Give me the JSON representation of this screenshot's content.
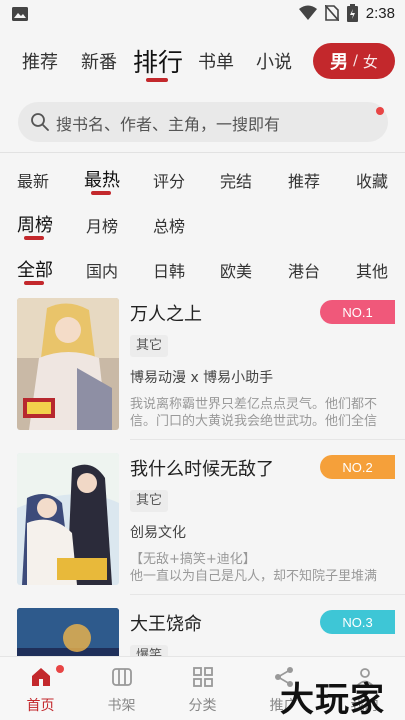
{
  "status_bar": {
    "time": "2:38"
  },
  "top_nav": {
    "tabs": [
      "推荐",
      "新番",
      "排行",
      "书单",
      "小说"
    ],
    "active_index": 2,
    "gender": {
      "male": "男",
      "separator": "/",
      "female": "女"
    }
  },
  "search": {
    "placeholder": "搜书名、作者、主角，一搜即有"
  },
  "filters": {
    "sort": {
      "items": [
        "最新",
        "最热",
        "评分",
        "完结",
        "推荐",
        "收藏"
      ],
      "active_index": 1
    },
    "period": {
      "items": [
        "周榜",
        "月榜",
        "总榜"
      ],
      "active_index": 0
    },
    "region": {
      "items": [
        "全部",
        "国内",
        "日韩",
        "欧美",
        "港台",
        "其他"
      ],
      "active_index": 0
    }
  },
  "books": [
    {
      "title": "万人之上",
      "rank": "NO.1",
      "rank_color": "#f0587a",
      "tag": "其它",
      "author": "博易动漫 x 博易小助手",
      "desc": "我说离称霸世界只差亿点点灵气。他们都不信。门口的大黄说我会绝世武功。他们全信"
    },
    {
      "title": "我什么时候无敌了",
      "rank": "NO.2",
      "rank_color": "#f5a03a",
      "tag": "其它",
      "author": "创易文化",
      "desc": "【无敌+搞笑+迪化】\n他一直以为自己是凡人，却不知院子里堆满"
    },
    {
      "title": "大王饶命",
      "rank": "NO.3",
      "rank_color": "#3ec6d6",
      "tag": "爆笑",
      "author": "",
      "desc": ""
    }
  ],
  "bottom_nav": {
    "items": [
      "首页",
      "书架",
      "分类",
      "推广",
      "我的"
    ],
    "active_index": 0
  },
  "watermark": "大玩家",
  "colors": {
    "accent": "#c3282c",
    "background": "#f5f5f5"
  }
}
